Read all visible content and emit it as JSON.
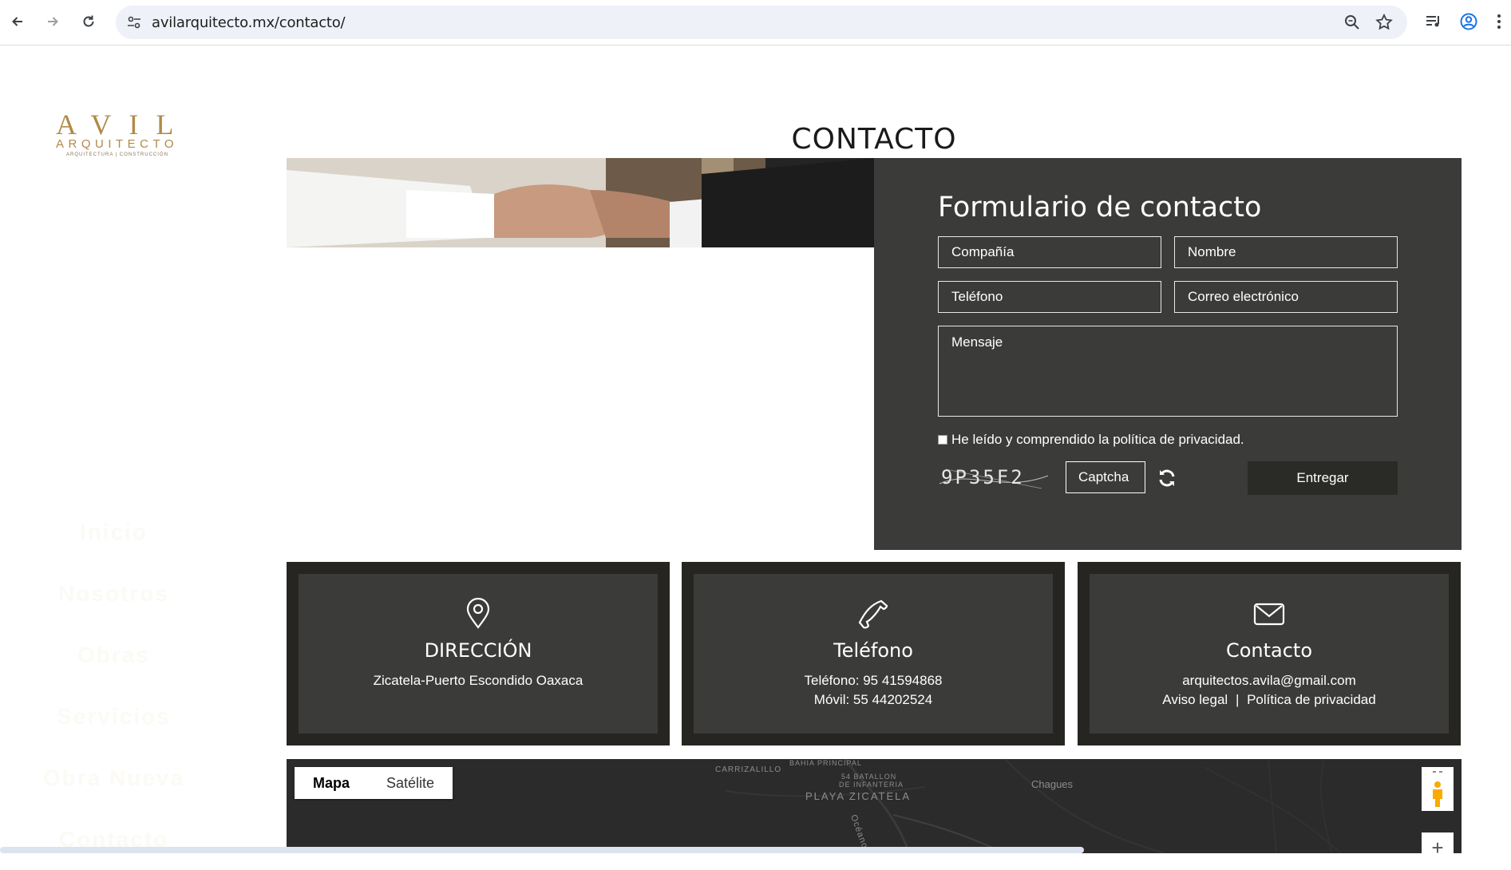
{
  "browser": {
    "url": "avilarquitecto.mx/contacto/"
  },
  "logo": {
    "main": "AVIL",
    "sub": "ARQUITECTO",
    "tagline": "ARQUITECTURA | CONSTRUCCIÓN"
  },
  "sidenav": {
    "items": [
      {
        "label": "Inicio"
      },
      {
        "label": "Nosotros"
      },
      {
        "label": "Obras"
      },
      {
        "label": "Servicios"
      },
      {
        "label": "Obra Nueva"
      },
      {
        "label": "Contacto"
      }
    ]
  },
  "page": {
    "title": "CONTACTO"
  },
  "form": {
    "heading": "Formulario de contacto",
    "company_placeholder": "Compañía",
    "name_placeholder": "Nombre",
    "phone_placeholder": "Teléfono",
    "email_placeholder": "Correo electrónico",
    "message_placeholder": "Mensaje",
    "privacy_label": "He leído y comprendido la política de privacidad.",
    "captcha_text": "9P35F2",
    "captcha_placeholder": "Captcha",
    "submit_label": "Entregar"
  },
  "cards": {
    "address": {
      "heading": "DIRECCIÓN",
      "line1": "Zicatela-Puerto Escondido Oaxaca"
    },
    "phone": {
      "heading": "Teléfono",
      "line1": "Teléfono: 95 41594868",
      "line2": "Móvil: 55 44202524"
    },
    "contact": {
      "heading": "Contacto",
      "email": "arquitectos.avila@gmail.com",
      "legal": "Aviso legal",
      "separator": "|",
      "privacy": "Política de privacidad"
    }
  },
  "map": {
    "tab_map": "Mapa",
    "tab_satellite": "Satélite",
    "labels": {
      "carrizalillo": "CARRIZALILLO",
      "bahia": "BAHIA PRINCIPAL",
      "batallon": "54 BATALLON",
      "infanteria": "DE INFANTERIA",
      "zicatela": "PLAYA ZICATELA",
      "chagues": "Chagues",
      "oceano": "Océano"
    },
    "zoom_in": "+"
  },
  "colors": {
    "accent_gold": "#b08a48",
    "panel_dark": "#3b3b3a",
    "card_border": "#262521"
  }
}
